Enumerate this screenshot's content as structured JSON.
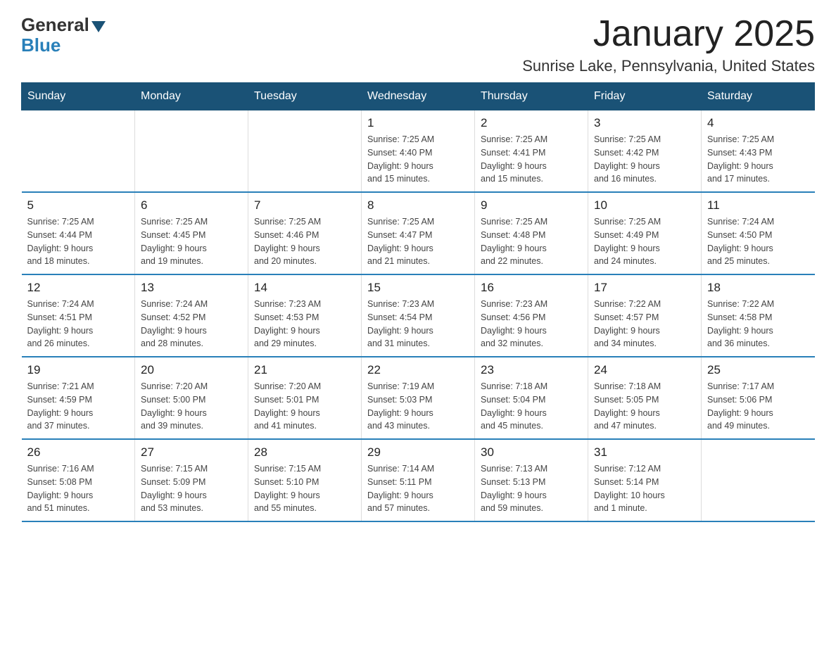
{
  "header": {
    "logo_general": "General",
    "logo_blue": "Blue",
    "month_title": "January 2025",
    "location": "Sunrise Lake, Pennsylvania, United States"
  },
  "days_of_week": [
    "Sunday",
    "Monday",
    "Tuesday",
    "Wednesday",
    "Thursday",
    "Friday",
    "Saturday"
  ],
  "weeks": [
    [
      {
        "day": "",
        "info": ""
      },
      {
        "day": "",
        "info": ""
      },
      {
        "day": "",
        "info": ""
      },
      {
        "day": "1",
        "info": "Sunrise: 7:25 AM\nSunset: 4:40 PM\nDaylight: 9 hours\nand 15 minutes."
      },
      {
        "day": "2",
        "info": "Sunrise: 7:25 AM\nSunset: 4:41 PM\nDaylight: 9 hours\nand 15 minutes."
      },
      {
        "day": "3",
        "info": "Sunrise: 7:25 AM\nSunset: 4:42 PM\nDaylight: 9 hours\nand 16 minutes."
      },
      {
        "day": "4",
        "info": "Sunrise: 7:25 AM\nSunset: 4:43 PM\nDaylight: 9 hours\nand 17 minutes."
      }
    ],
    [
      {
        "day": "5",
        "info": "Sunrise: 7:25 AM\nSunset: 4:44 PM\nDaylight: 9 hours\nand 18 minutes."
      },
      {
        "day": "6",
        "info": "Sunrise: 7:25 AM\nSunset: 4:45 PM\nDaylight: 9 hours\nand 19 minutes."
      },
      {
        "day": "7",
        "info": "Sunrise: 7:25 AM\nSunset: 4:46 PM\nDaylight: 9 hours\nand 20 minutes."
      },
      {
        "day": "8",
        "info": "Sunrise: 7:25 AM\nSunset: 4:47 PM\nDaylight: 9 hours\nand 21 minutes."
      },
      {
        "day": "9",
        "info": "Sunrise: 7:25 AM\nSunset: 4:48 PM\nDaylight: 9 hours\nand 22 minutes."
      },
      {
        "day": "10",
        "info": "Sunrise: 7:25 AM\nSunset: 4:49 PM\nDaylight: 9 hours\nand 24 minutes."
      },
      {
        "day": "11",
        "info": "Sunrise: 7:24 AM\nSunset: 4:50 PM\nDaylight: 9 hours\nand 25 minutes."
      }
    ],
    [
      {
        "day": "12",
        "info": "Sunrise: 7:24 AM\nSunset: 4:51 PM\nDaylight: 9 hours\nand 26 minutes."
      },
      {
        "day": "13",
        "info": "Sunrise: 7:24 AM\nSunset: 4:52 PM\nDaylight: 9 hours\nand 28 minutes."
      },
      {
        "day": "14",
        "info": "Sunrise: 7:23 AM\nSunset: 4:53 PM\nDaylight: 9 hours\nand 29 minutes."
      },
      {
        "day": "15",
        "info": "Sunrise: 7:23 AM\nSunset: 4:54 PM\nDaylight: 9 hours\nand 31 minutes."
      },
      {
        "day": "16",
        "info": "Sunrise: 7:23 AM\nSunset: 4:56 PM\nDaylight: 9 hours\nand 32 minutes."
      },
      {
        "day": "17",
        "info": "Sunrise: 7:22 AM\nSunset: 4:57 PM\nDaylight: 9 hours\nand 34 minutes."
      },
      {
        "day": "18",
        "info": "Sunrise: 7:22 AM\nSunset: 4:58 PM\nDaylight: 9 hours\nand 36 minutes."
      }
    ],
    [
      {
        "day": "19",
        "info": "Sunrise: 7:21 AM\nSunset: 4:59 PM\nDaylight: 9 hours\nand 37 minutes."
      },
      {
        "day": "20",
        "info": "Sunrise: 7:20 AM\nSunset: 5:00 PM\nDaylight: 9 hours\nand 39 minutes."
      },
      {
        "day": "21",
        "info": "Sunrise: 7:20 AM\nSunset: 5:01 PM\nDaylight: 9 hours\nand 41 minutes."
      },
      {
        "day": "22",
        "info": "Sunrise: 7:19 AM\nSunset: 5:03 PM\nDaylight: 9 hours\nand 43 minutes."
      },
      {
        "day": "23",
        "info": "Sunrise: 7:18 AM\nSunset: 5:04 PM\nDaylight: 9 hours\nand 45 minutes."
      },
      {
        "day": "24",
        "info": "Sunrise: 7:18 AM\nSunset: 5:05 PM\nDaylight: 9 hours\nand 47 minutes."
      },
      {
        "day": "25",
        "info": "Sunrise: 7:17 AM\nSunset: 5:06 PM\nDaylight: 9 hours\nand 49 minutes."
      }
    ],
    [
      {
        "day": "26",
        "info": "Sunrise: 7:16 AM\nSunset: 5:08 PM\nDaylight: 9 hours\nand 51 minutes."
      },
      {
        "day": "27",
        "info": "Sunrise: 7:15 AM\nSunset: 5:09 PM\nDaylight: 9 hours\nand 53 minutes."
      },
      {
        "day": "28",
        "info": "Sunrise: 7:15 AM\nSunset: 5:10 PM\nDaylight: 9 hours\nand 55 minutes."
      },
      {
        "day": "29",
        "info": "Sunrise: 7:14 AM\nSunset: 5:11 PM\nDaylight: 9 hours\nand 57 minutes."
      },
      {
        "day": "30",
        "info": "Sunrise: 7:13 AM\nSunset: 5:13 PM\nDaylight: 9 hours\nand 59 minutes."
      },
      {
        "day": "31",
        "info": "Sunrise: 7:12 AM\nSunset: 5:14 PM\nDaylight: 10 hours\nand 1 minute."
      },
      {
        "day": "",
        "info": ""
      }
    ]
  ]
}
